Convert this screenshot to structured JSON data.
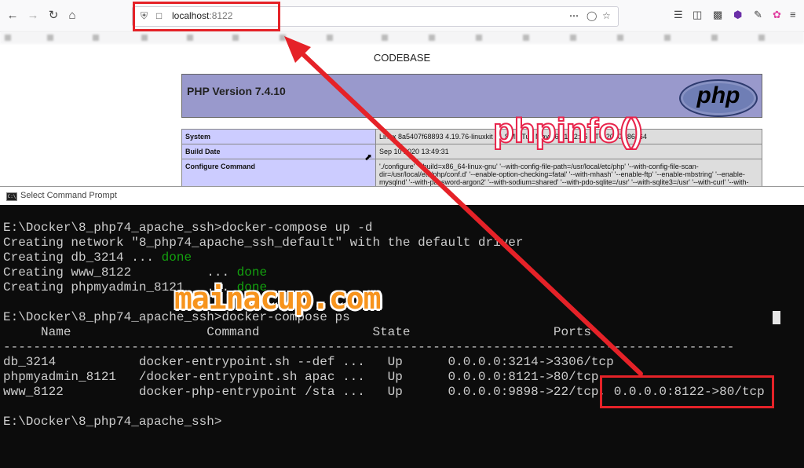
{
  "browser": {
    "url_host": "localhost",
    "url_port": ":8122",
    "icons": [
      "back-icon",
      "forward-icon",
      "reload-icon",
      "home-icon",
      "shield-icon",
      "page-icon",
      "more-icon",
      "pocket-icon",
      "star-icon",
      "library-icon",
      "sidebar-icon",
      "extension-icon",
      "eyedropper-icon",
      "colorwheel-icon",
      "menu-icon"
    ]
  },
  "page": {
    "title": "CODEBASE",
    "php_version": "PHP Version 7.4.10",
    "logo_text": "php",
    "rows": [
      {
        "key": "System",
        "value": "Linux 8a5407f68893 4.19.76-linuxkit #1 SMP Tue May 26 11:42:35 UTC 2020 x86_64"
      },
      {
        "key": "Build Date",
        "value": "Sep 10 2020 13:49:31"
      },
      {
        "key": "Configure Command",
        "value": "'./configure' '--build=x86_64-linux-gnu' '--with-config-file-path=/usr/local/etc/php' '--with-config-file-scan-dir=/usr/local/etc/php/conf.d' '--enable-option-checking=fatal' '--with-mhash' '--enable-ftp' '--enable-mbstring' '--enable-mysqlnd' '--with-password-argon2' '--with-sodium=shared' '--with-pdo-sqlite=/usr' '--with-sqlite3=/usr' '--with-curl' '--with-libedit' '--"
      }
    ]
  },
  "cmd": {
    "title": "Select Command Prompt",
    "icon_text": "C:\\",
    "lines": {
      "l1": "E:\\Docker\\8_php74_apache_ssh>docker-compose up -d",
      "l2": "Creating network \"8_php74_apache_ssh_default\" with the default driver",
      "l3a": "Creating db_3214 ... ",
      "l3b": "done",
      "l4a": "Creating www_8122          ... ",
      "l4b": "done",
      "l5a": "Creating phpmyadmin_8121   ... ",
      "l5b": "done",
      "l6": "E:\\Docker\\8_php74_apache_ssh>docker-compose ps",
      "l7": "     Name                  Command               State                   Ports",
      "l8": "-------------------------------------------------------------------------------------------------",
      "l9": "db_3214           docker-entrypoint.sh --def ...   Up      0.0.0.0:3214->3306/tcp",
      "l10": "phpmyadmin_8121   /docker-entrypoint.sh apac ...   Up      0.0.0.0:8121->80/tcp",
      "l11": "www_8122          docker-php-entrypoint /sta ...   Up      0.0.0.0:9898->22/tcp, 0.0.0.0:8122->80/tcp",
      "l12": "E:\\Docker\\8_php74_apache_ssh>"
    }
  },
  "annotations": {
    "callout": "phpinfo()",
    "watermark": "mainacup.com",
    "accent_color": "#e52228"
  }
}
